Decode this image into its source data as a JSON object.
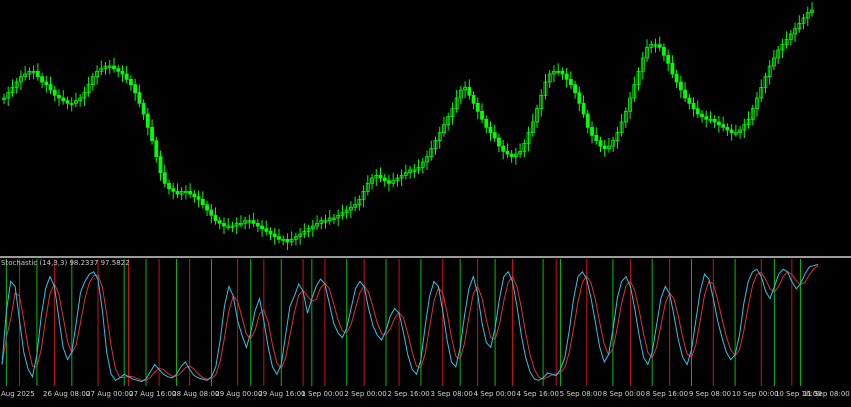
{
  "colors": {
    "background": "#000000",
    "candle": "#00ff00",
    "separator": "#9a9a9a",
    "main_line": "#2ec4e6",
    "signal_line": "#e03030",
    "cross_up": "#00c000",
    "cross_down": "#d01010"
  },
  "chart_data": [
    {
      "type": "candlestick",
      "title": "",
      "grid": false,
      "price_series": [
        60,
        62,
        64,
        66,
        68,
        69,
        70,
        70,
        68,
        66,
        65,
        63,
        61,
        60,
        59,
        58,
        58,
        59,
        60,
        62,
        65,
        68,
        70,
        71,
        72,
        72,
        71,
        70,
        69,
        67,
        65,
        62,
        58,
        54,
        49,
        44,
        38,
        32,
        28,
        26,
        25,
        24,
        25,
        25,
        24,
        23,
        22,
        20,
        18,
        16,
        14,
        13,
        12,
        12,
        12,
        13,
        13,
        14,
        14,
        13,
        12,
        11,
        10,
        9,
        8,
        7,
        7,
        6,
        7,
        8,
        9,
        10,
        11,
        12,
        13,
        14,
        14,
        15,
        15,
        16,
        17,
        18,
        19,
        20,
        22,
        25,
        28,
        30,
        31,
        30,
        29,
        28,
        29,
        30,
        31,
        32,
        33,
        33,
        34,
        36,
        38,
        41,
        44,
        47,
        50,
        53,
        56,
        60,
        63,
        64,
        61,
        58,
        55,
        52,
        49,
        47,
        45,
        42,
        40,
        39,
        38,
        39,
        40,
        43,
        47,
        51,
        56,
        61,
        66,
        69,
        70,
        70,
        69,
        67,
        65,
        62,
        58,
        54,
        49,
        46,
        44,
        42,
        41,
        42,
        44,
        47,
        51,
        55,
        60,
        65,
        70,
        75,
        79,
        80,
        80,
        79,
        76,
        73,
        69,
        66,
        63,
        60,
        58,
        56,
        54,
        53,
        52,
        52,
        51,
        50,
        49,
        48,
        47,
        47,
        48,
        50,
        52,
        56,
        60,
        64,
        68,
        72,
        75,
        78,
        80,
        82,
        84,
        86,
        88,
        90,
        92,
        93
      ],
      "oscillator": {
        "name": "Stochastic",
        "params": "14,3,3",
        "values": [
          98.2337,
          97.5822
        ],
        "ylim": [
          0,
          100
        ],
        "main_line": [
          16,
          60,
          84,
          80,
          52,
          26,
          12,
          6,
          24,
          56,
          78,
          88,
          80,
          55,
          30,
          20,
          26,
          50,
          75,
          84,
          90,
          92,
          86,
          60,
          26,
          8,
          3,
          5,
          8,
          6,
          4,
          3,
          2,
          4,
          10,
          16,
          12,
          8,
          6,
          5,
          8,
          14,
          18,
          12,
          7,
          5,
          4,
          3,
          6,
          14,
          36,
          64,
          80,
          72,
          52,
          40,
          30,
          42,
          60,
          70,
          52,
          30,
          14,
          8,
          16,
          40,
          64,
          72,
          82,
          76,
          58,
          70,
          80,
          86,
          82,
          66,
          50,
          42,
          38,
          46,
          62,
          78,
          84,
          80,
          62,
          48,
          40,
          36,
          44,
          56,
          62,
          58,
          42,
          24,
          12,
          8,
          20,
          48,
          72,
          84,
          80,
          60,
          36,
          18,
          14,
          30,
          56,
          78,
          88,
          74,
          50,
          34,
          30,
          46,
          70,
          88,
          92,
          84,
          64,
          40,
          22,
          10,
          4,
          3,
          5,
          9,
          8,
          7,
          12,
          22,
          44,
          70,
          88,
          92,
          86,
          70,
          50,
          30,
          18,
          24,
          44,
          70,
          84,
          88,
          80,
          62,
          40,
          22,
          16,
          26,
          48,
          70,
          80,
          74,
          56,
          36,
          22,
          16,
          28,
          52,
          76,
          90,
          86,
          70,
          52,
          38,
          26,
          20,
          24,
          40,
          66,
          84,
          92,
          94,
          88,
          76,
          70,
          80,
          90,
          94,
          92,
          84,
          78,
          82,
          90,
          96,
          97,
          98
        ]
      }
    }
  ],
  "x_axis": {
    "labels": [
      "Aug 2025",
      "26 Aug 08:00",
      "27 Aug 00:00",
      "27 Aug 16:00",
      "28 Aug 08:00",
      "29 Aug 00:00",
      "29 Aug 16:00",
      "1 Sep 00:00",
      "2 Sep 00:00",
      "2 Sep 16:00",
      "3 Sep 08:00",
      "4 Sep 00:00",
      "4 Sep 16:00",
      "5 Sep 08:00",
      "8 Sep 00:00",
      "8 Sep 16:00",
      "9 Sep 08:00",
      "10 Sep 00:00",
      "10 Sep 16:00",
      "11 Sep 08:00"
    ]
  },
  "indicator_label": {
    "name": "Stochastic",
    "params": "(14,3,3)",
    "value_main": "98.2337",
    "value_signal": "97.5822"
  }
}
